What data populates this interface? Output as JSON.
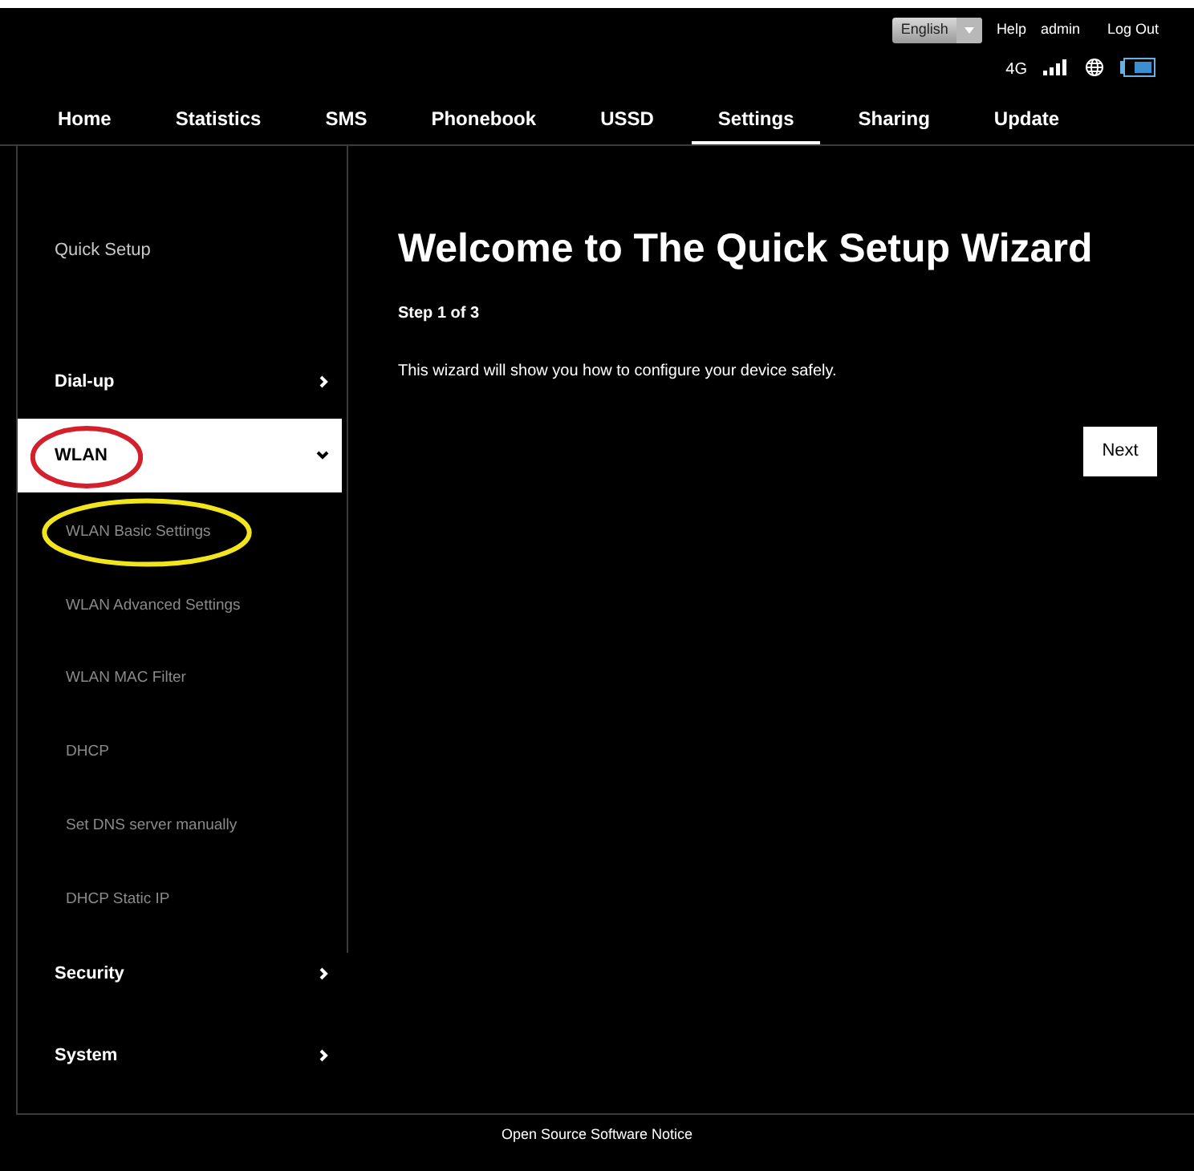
{
  "header": {
    "language": {
      "value": "English"
    },
    "links": [
      "Help",
      "admin",
      "Log Out"
    ],
    "network": "4G"
  },
  "nav": [
    {
      "label": "Home",
      "selected": false
    },
    {
      "label": "Statistics",
      "selected": false
    },
    {
      "label": "SMS",
      "selected": false
    },
    {
      "label": "Phonebook",
      "selected": false
    },
    {
      "label": "USSD",
      "selected": false
    },
    {
      "label": "Settings",
      "selected": true
    },
    {
      "label": "Sharing",
      "selected": false
    },
    {
      "label": "Update",
      "selected": false
    }
  ],
  "sidebar": {
    "items": [
      {
        "label": "Quick Setup",
        "kind": "plain"
      },
      {
        "label": "Dial-up",
        "kind": "group",
        "expanded": false
      },
      {
        "label": "WLAN",
        "kind": "group",
        "expanded": true,
        "annotation": {
          "color": "#d4202c"
        },
        "children": [
          {
            "label": "WLAN Basic Settings",
            "annotation": {
              "color": "#f2e51c"
            }
          },
          {
            "label": "WLAN Advanced Settings"
          },
          {
            "label": "WLAN MAC Filter"
          },
          {
            "label": "DHCP"
          },
          {
            "label": "Set DNS server manually"
          },
          {
            "label": "DHCP Static IP"
          }
        ]
      },
      {
        "label": "Security",
        "kind": "group",
        "expanded": false
      },
      {
        "label": "System",
        "kind": "group",
        "expanded": false
      }
    ]
  },
  "main": {
    "title": "Welcome to The Quick Setup Wizard",
    "step": "Step 1 of 3",
    "description": "This wizard will show you how to configure your device safely.",
    "button": "Next"
  },
  "footer": "Open Source Software Notice"
}
